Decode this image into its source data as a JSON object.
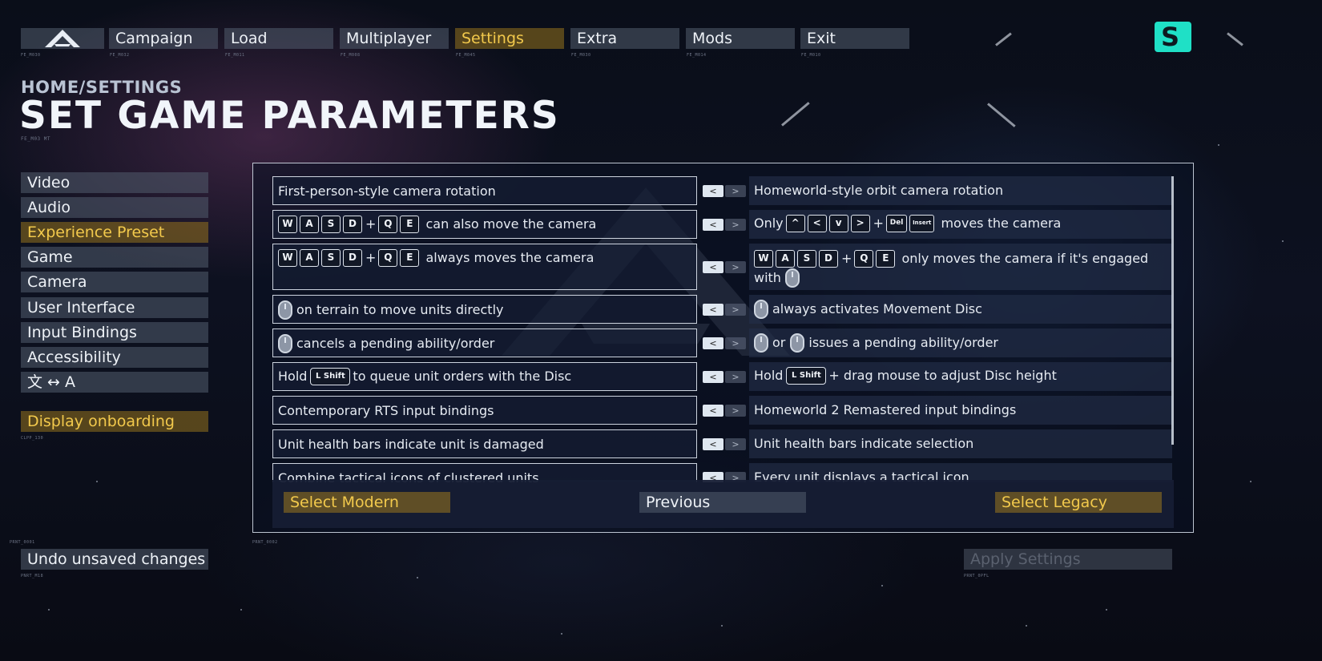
{
  "top_nav": {
    "items": [
      {
        "label": "",
        "code": "FE_M030"
      },
      {
        "label": "Campaign",
        "code": "FE_M032"
      },
      {
        "label": "Load",
        "code": "FE_M011"
      },
      {
        "label": "Multiplayer",
        "code": "FE_M008"
      },
      {
        "label": "Settings",
        "code": "FE_M045",
        "active": true
      },
      {
        "label": "Extra",
        "code": "FE_M030"
      },
      {
        "label": "Mods",
        "code": "FE_M014"
      },
      {
        "label": "Exit",
        "code": "FE_M010"
      }
    ]
  },
  "header": {
    "breadcrumb": "HOME/SETTINGS",
    "title": "SET GAME PARAMETERS",
    "title_code": "FE_M03 MT"
  },
  "sidebar": {
    "items": [
      {
        "label": "Video"
      },
      {
        "label": "Audio"
      },
      {
        "label": "Experience Preset",
        "active": true
      },
      {
        "label": "Game"
      },
      {
        "label": "Camera"
      },
      {
        "label": "User Interface"
      },
      {
        "label": "Input Bindings"
      },
      {
        "label": "Accessibility"
      },
      {
        "label": "文 ↔ A"
      }
    ],
    "onboarding_label": "Display onboarding",
    "onboarding_code": "CLPP_130",
    "undo_label": "Undo unsaved changes",
    "undo_code": "PNRT_M18"
  },
  "options": {
    "rows": [
      {
        "left": {
          "text": "First-person-style camera rotation"
        },
        "right": {
          "text": "Homeworld-style orbit camera rotation"
        }
      },
      {
        "left": {
          "keys": [
            "W",
            "A",
            "S",
            "D"
          ],
          "plus": "+",
          "keys2": [
            "Q",
            "E"
          ],
          "text": "can also move the camera"
        },
        "right": {
          "prefix": "Only",
          "keys": [
            "^",
            "<",
            "v",
            ">"
          ],
          "plus": "+",
          "keys2": [
            "Del",
            "Insert"
          ],
          "text": "moves the camera"
        }
      },
      {
        "left": {
          "keys": [
            "W",
            "A",
            "S",
            "D"
          ],
          "plus": "+",
          "keys2": [
            "Q",
            "E"
          ],
          "text": "always moves the camera"
        },
        "right": {
          "keys": [
            "W",
            "A",
            "S",
            "D"
          ],
          "plus": "+",
          "keys2": [
            "Q",
            "E"
          ],
          "text": "only moves the camera if it's engaged with"
        }
      },
      {
        "left": {
          "text": "on terrain to move units directly"
        },
        "right": {
          "text": "always activates Movement Disc"
        }
      },
      {
        "left": {
          "text": "cancels a pending ability/order"
        },
        "right": {
          "or": "or",
          "text": "issues a pending ability/order"
        }
      },
      {
        "left": {
          "prefix": "Hold",
          "key": "L Shift",
          "text": "to queue unit orders with the Disc"
        },
        "right": {
          "prefix": "Hold",
          "key": "L Shift",
          "text": "+ drag mouse to adjust Disc height"
        }
      },
      {
        "left": {
          "text": "Contemporary RTS input bindings"
        },
        "right": {
          "text": "Homeworld 2 Remastered input bindings"
        }
      },
      {
        "left": {
          "text": "Unit health bars indicate unit is damaged"
        },
        "right": {
          "text": "Unit health bars indicate selection"
        }
      },
      {
        "left": {
          "text": "Combine tactical icons of clustered units"
        },
        "right": {
          "text": "Every unit displays a tactical icon"
        }
      }
    ],
    "toggle": {
      "left_glyph": "<",
      "right_glyph": ">"
    }
  },
  "panel_buttons": {
    "select_modern": "Select Modern",
    "previous": "Previous",
    "select_legacy": "Select Legacy",
    "code_left": "PRNT_0001",
    "code_right": "PRNT_0002"
  },
  "apply_button": {
    "label": "Apply Settings",
    "code": "PRNT_0PFL"
  },
  "logo_letter": "S",
  "colors": {
    "accent_gold": "#f2c94c",
    "logo_teal": "#1fe0c6",
    "background": "#0a0e19"
  }
}
